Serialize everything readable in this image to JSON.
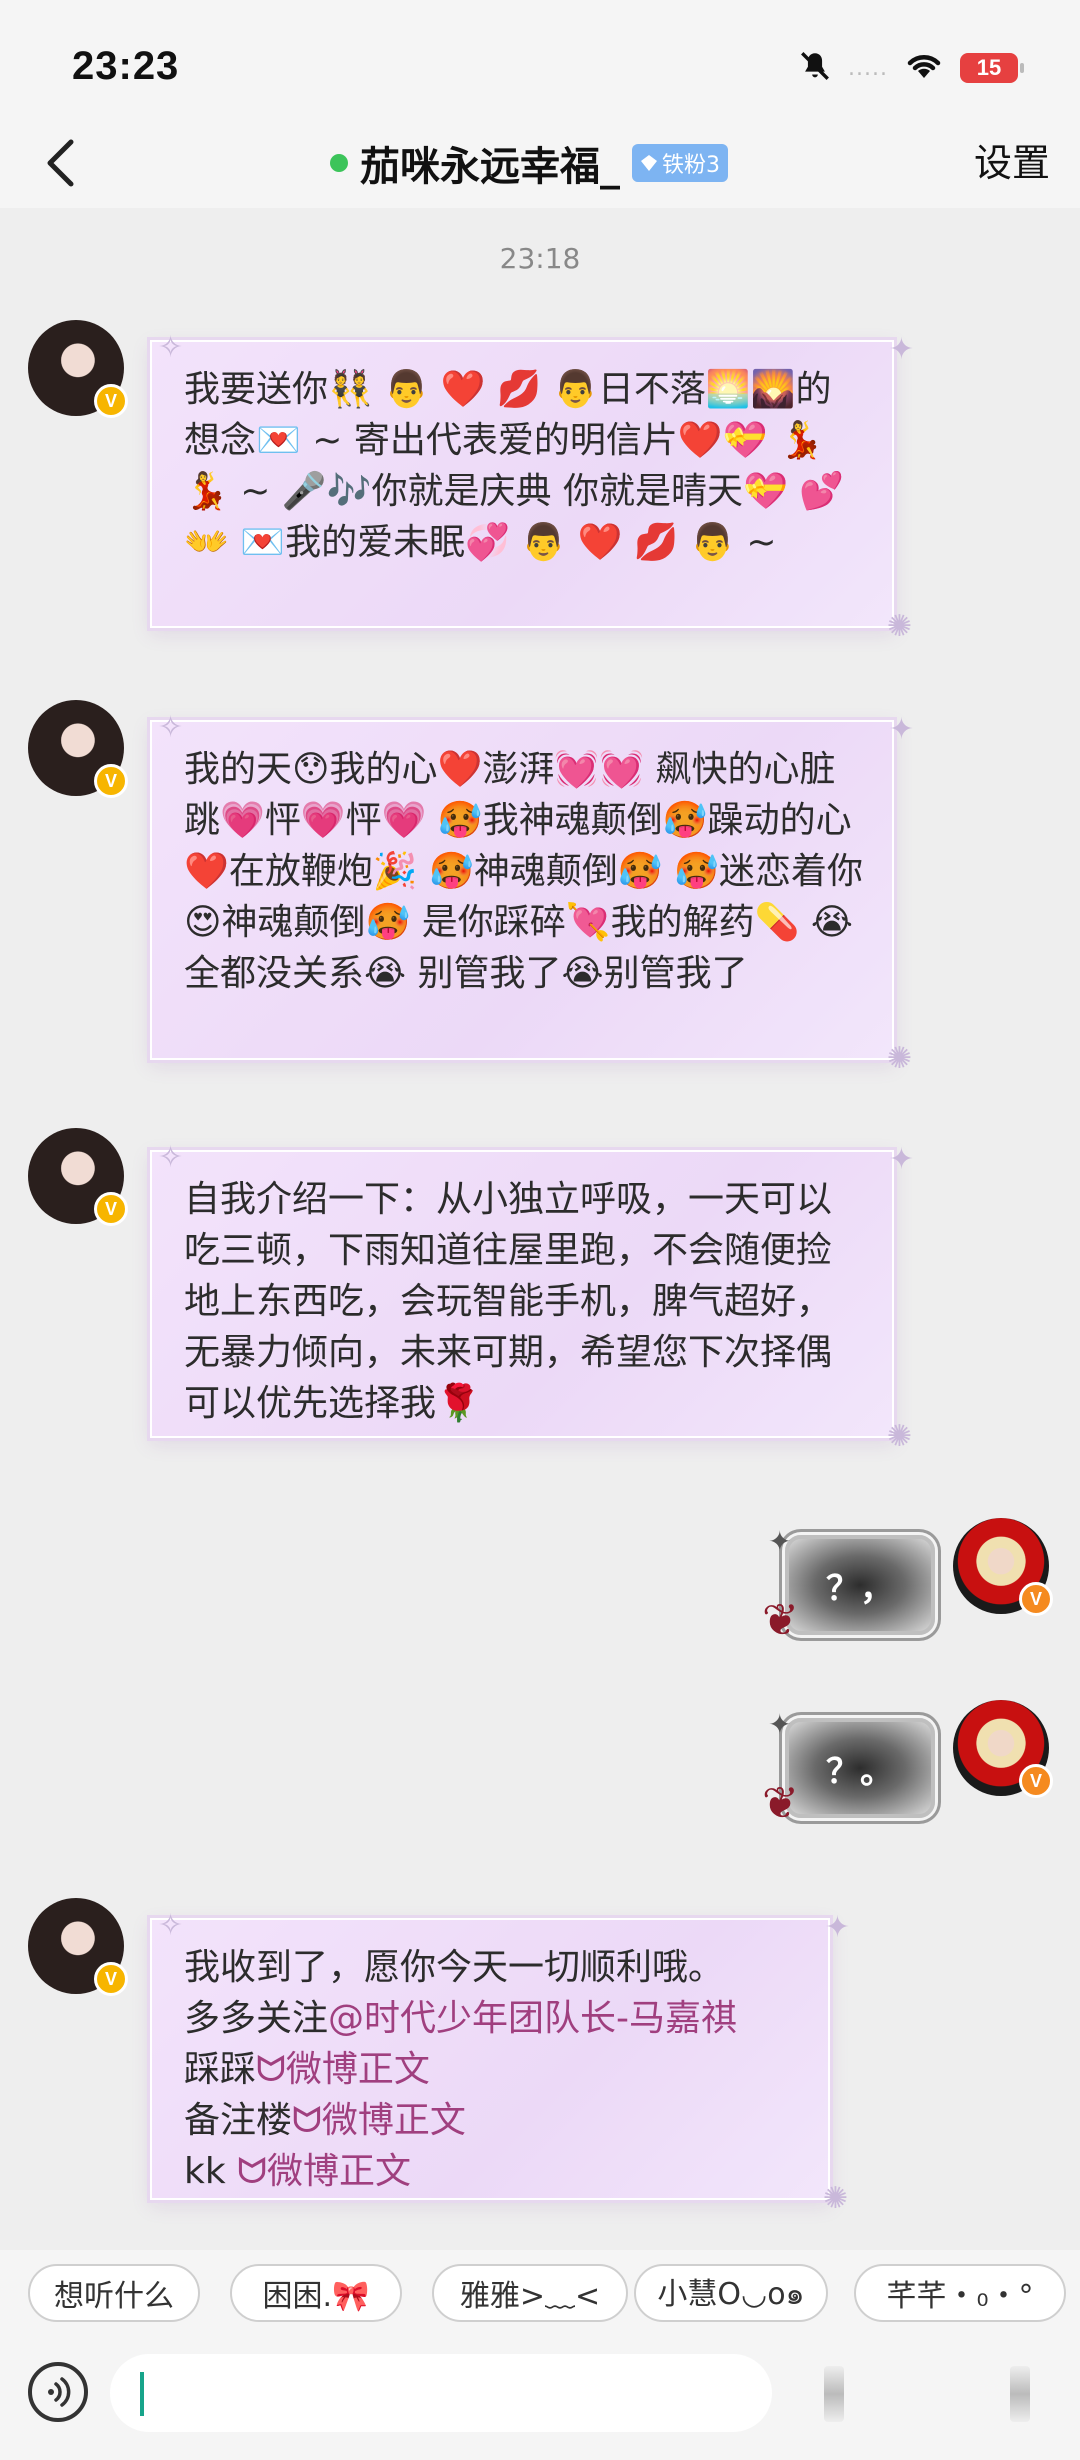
{
  "status_bar": {
    "time": "23:23",
    "battery": "15",
    "signal": "....."
  },
  "header": {
    "back_icon": "chevron-left-icon",
    "title": "茄咪永远幸福_",
    "online_color": "#3cc45a",
    "badge": "铁粉3",
    "settings": "设置"
  },
  "chat": {
    "timestamp": "23:18",
    "messages": [
      {
        "side": "left",
        "text": "我要送你👯 👨 ❤️ 💋 👨日不落🌅🌄的想念💌 ~ 寄出代表爱的明信片❤️💝 💃 💃 ~ 🎤🎶你就是庆典 你就是晴天💝 💕 👐 💌我的爱未眠💞 👨 ❤️ 💋 👨 ~"
      },
      {
        "side": "left",
        "text": "我的天😯我的心❤️澎湃💓💓 飙快的心脏跳💗怦💗怦💗 🥵我神魂颠倒🥵躁动的心❤️在放鞭炮🎉 🥵神魂颠倒🥵 🥵迷恋着你😍神魂颠倒🥵 是你踩碎💘我的解药💊 😭全都没关系😭 别管我了😭别管我了"
      },
      {
        "side": "left",
        "text": "自我介绍一下：从小独立呼吸，一天可以吃三顿，下雨知道往屋里跑，不会随便捡地上东西吃，会玩智能手机，脾气超好，无暴力倾向，未来可期，希望您下次择偶可以优先选择我🌹"
      },
      {
        "side": "right",
        "sticker_text": "？，"
      },
      {
        "side": "right",
        "sticker_text": "？。"
      },
      {
        "side": "left",
        "line1": "我收到了，愿你今天一切顺利哦。",
        "line2_prefix": "多多关注",
        "line2_mention": "@时代少年团队长-马嘉祺",
        "line3_prefix": "踩踩",
        "line3_link": "微博正文",
        "line4_prefix": "备注楼",
        "line4_link": "微博正文",
        "line5_prefix": "kk ",
        "line5_link": "微博正文"
      }
    ]
  },
  "quick_replies": [
    "想听什么",
    "困困.🎀",
    "雅雅>﹏<",
    "小慧O◡o๑",
    "芊芊・₀・°"
  ],
  "input": {
    "value": "",
    "voice_icon": "voice-wave-icon"
  },
  "colors": {
    "mention": "#a03f7f",
    "bubble": "#efdef8",
    "caret": "#17a48a"
  }
}
